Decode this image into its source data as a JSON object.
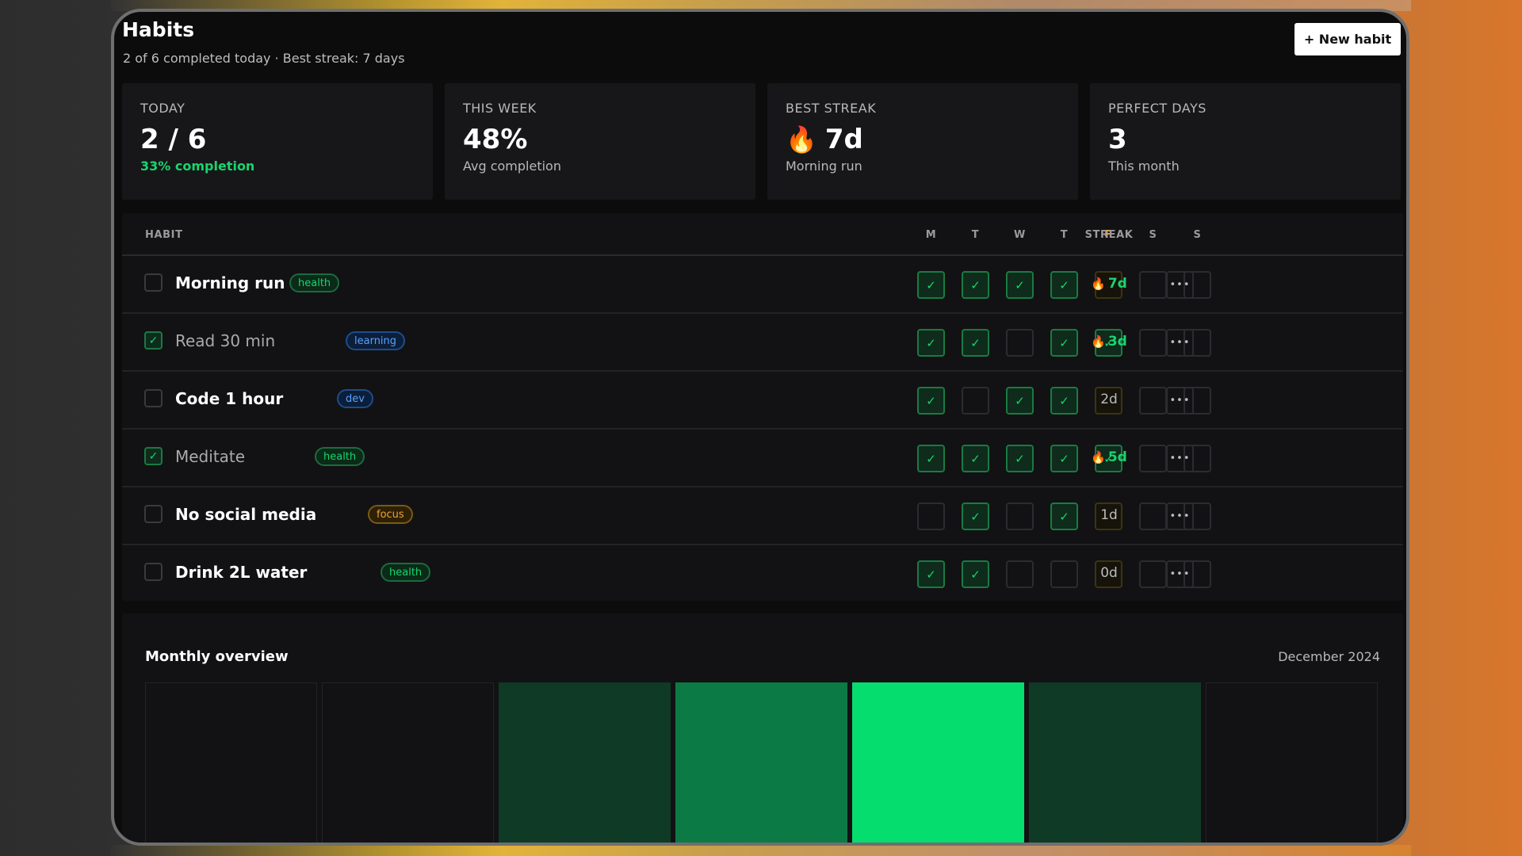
{
  "header": {
    "title": "Habits",
    "subtitle": "2 of 6 completed today · Best streak: 7 days",
    "new_habit_label": "+ New habit"
  },
  "stats": [
    {
      "label": "TODAY",
      "value": "2 / 6",
      "sub": "33% completion",
      "sub_accent": true
    },
    {
      "label": "THIS WEEK",
      "value": "48%",
      "sub": "Avg completion"
    },
    {
      "label": "BEST STREAK",
      "value": "7d",
      "icon": "flame-icon",
      "sub": "Morning run"
    },
    {
      "label": "PERFECT DAYS",
      "value": "3",
      "sub": "This month"
    }
  ],
  "table": {
    "habit_header": "HABIT",
    "day_headers": [
      "M",
      "T",
      "W",
      "T",
      "F",
      "S",
      "S"
    ],
    "today_index": 4,
    "streak_header": "STREAK",
    "rows": [
      {
        "name": "Morning run",
        "tag": "health",
        "done_today": false,
        "days": [
          1,
          1,
          1,
          1,
          0,
          0,
          0
        ],
        "streak": "7d",
        "hot": true
      },
      {
        "name": "Read 30 min",
        "tag": "learning",
        "done_today": true,
        "days": [
          1,
          1,
          0,
          1,
          1,
          0,
          0
        ],
        "streak": "3d",
        "hot": true
      },
      {
        "name": "Code 1 hour",
        "tag": "dev",
        "done_today": false,
        "days": [
          1,
          0,
          1,
          1,
          0,
          0,
          0
        ],
        "streak": "2d",
        "hot": false
      },
      {
        "name": "Meditate",
        "tag": "health",
        "done_today": true,
        "days": [
          1,
          1,
          1,
          1,
          1,
          0,
          0
        ],
        "streak": "5d",
        "hot": true
      },
      {
        "name": "No social media",
        "tag": "focus",
        "done_today": false,
        "days": [
          0,
          1,
          0,
          1,
          0,
          0,
          0
        ],
        "streak": "1d",
        "hot": false
      },
      {
        "name": "Drink 2L water",
        "tag": "health",
        "done_today": false,
        "days": [
          1,
          1,
          0,
          0,
          0,
          0,
          0
        ],
        "streak": "0d",
        "hot": false
      }
    ]
  },
  "monthly": {
    "title": "Monthly overview",
    "month": "December 2024",
    "cell_levels": [
      0,
      0,
      1,
      2,
      4,
      1,
      0
    ]
  },
  "colors": {
    "accent_green": "#19d46d",
    "today_accent": "#e8a53a",
    "heat": [
      "#121214",
      "#0f3a26",
      "#0c7a44",
      "#10a85a",
      "#06dd6f"
    ]
  }
}
